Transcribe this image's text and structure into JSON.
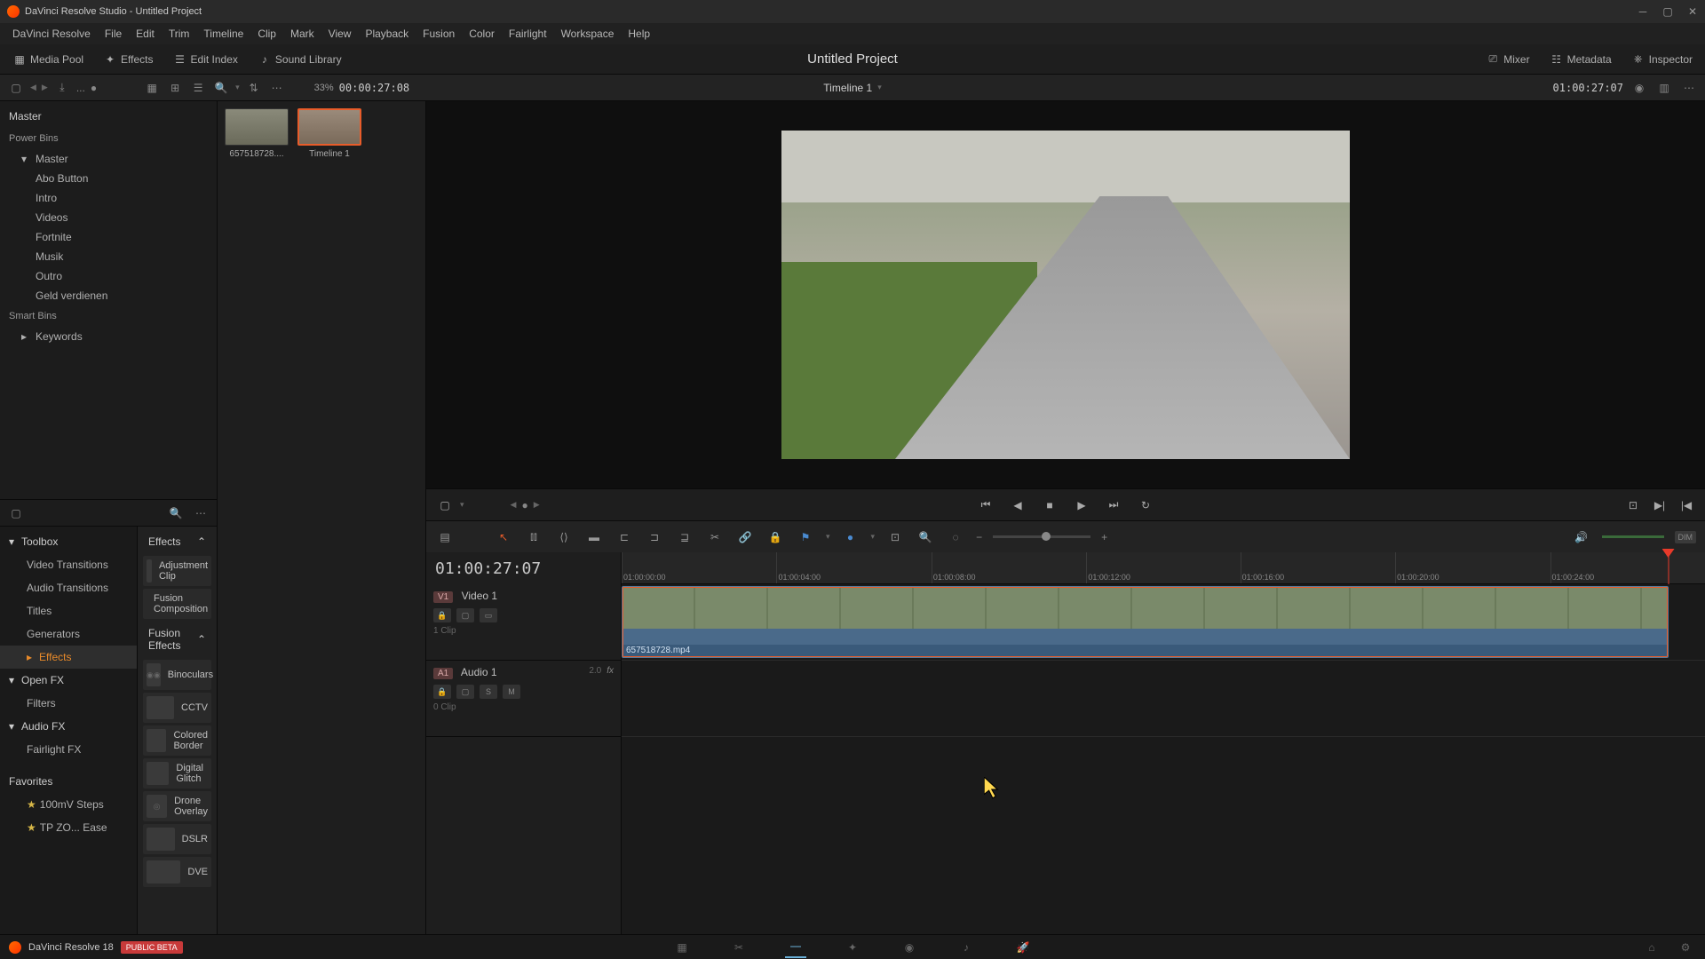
{
  "titlebar": {
    "title": "DaVinci Resolve Studio - Untitled Project"
  },
  "menubar": [
    "DaVinci Resolve",
    "File",
    "Edit",
    "Trim",
    "Timeline",
    "Clip",
    "Mark",
    "View",
    "Playback",
    "Fusion",
    "Color",
    "Fairlight",
    "Workspace",
    "Help"
  ],
  "top_toolbar": {
    "media_pool": "Media Pool",
    "effects": "Effects",
    "edit_index": "Edit Index",
    "sound_library": "Sound Library",
    "project_title": "Untitled Project",
    "mixer": "Mixer",
    "metadata": "Metadata",
    "inspector": "Inspector"
  },
  "sub_toolbar": {
    "zoom_pct": "33%",
    "src_tc": "00:00:27:08",
    "timeline_name": "Timeline 1",
    "rec_tc": "01:00:27:07"
  },
  "bins": {
    "master": "Master",
    "power_bins_label": "Power Bins",
    "power_bin_root": "Master",
    "items": [
      "Abo Button",
      "Intro",
      "Videos",
      "Fortnite",
      "Musik",
      "Outro",
      "Geld verdienen"
    ],
    "smart_bins_label": "Smart Bins",
    "smart_items": [
      "Keywords"
    ]
  },
  "fx_nav": {
    "toolbox": "Toolbox",
    "video_transitions": "Video Transitions",
    "audio_transitions": "Audio Transitions",
    "titles": "Titles",
    "generators": "Generators",
    "effects": "Effects",
    "openfx": "Open FX",
    "filters": "Filters",
    "audiofx": "Audio FX",
    "fairlightfx": "Fairlight FX",
    "favorites": "Favorites",
    "fav_items": [
      "100mV Steps",
      "TP ZO... Ease"
    ]
  },
  "fx_list": {
    "effects_hdr": "Effects",
    "effects_items": [
      "Adjustment Clip",
      "Fusion Composition"
    ],
    "fusion_hdr": "Fusion Effects",
    "fusion_items": [
      "Binoculars",
      "CCTV",
      "Colored Border",
      "Digital Glitch",
      "Drone Overlay",
      "DSLR",
      "DVE"
    ]
  },
  "thumbs": {
    "clip1_label": "657518728....",
    "clip2_label": "Timeline 1"
  },
  "timeline": {
    "big_tc": "01:00:27:07",
    "ticks": [
      "01:00:00:00",
      "01:00:04:00",
      "01:00:08:00",
      "01:00:12:00",
      "01:00:16:00",
      "01:00:20:00",
      "01:00:24:00"
    ],
    "video_track": {
      "badge": "V1",
      "name": "Video 1",
      "info": "1 Clip"
    },
    "audio_track": {
      "badge": "A1",
      "name": "Audio 1",
      "fx": "fx",
      "level": "2.0",
      "info": "0 Clip",
      "s": "S",
      "m": "M"
    },
    "clip_name": "657518728.mp4"
  },
  "page_bar": {
    "version": "DaVinci Resolve 18",
    "beta": "PUBLIC BETA"
  }
}
